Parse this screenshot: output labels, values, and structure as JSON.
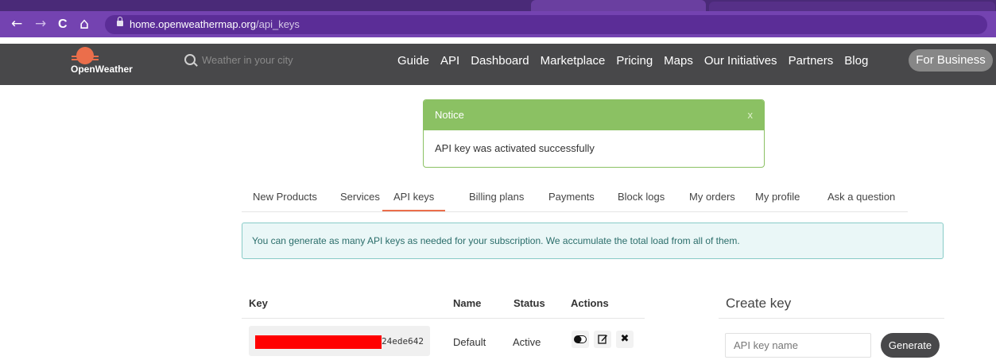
{
  "browser": {
    "url_host": "home.openweathermap.org",
    "url_path": "/api_keys",
    "back_glyph": "←",
    "forward_glyph": "→",
    "reload_glyph": "C",
    "home_glyph": "⌂"
  },
  "header": {
    "logo_text": "OpenWeather",
    "search_placeholder": "Weather in your city",
    "nav": [
      "Guide",
      "API",
      "Dashboard",
      "Marketplace",
      "Pricing",
      "Maps",
      "Our Initiatives",
      "Partners",
      "Blog"
    ],
    "for_business": "For Business"
  },
  "notice": {
    "title": "Notice",
    "close": "x",
    "message": "API key was activated successfully"
  },
  "account_tabs": [
    "New Products",
    "Services",
    "API keys",
    "Billing plans",
    "Payments",
    "Block logs",
    "My orders",
    "My profile",
    "Ask a question"
  ],
  "active_tab": "API keys",
  "info_text": "You can generate as many API keys as needed for your subscription. We accumulate the total load from all of them.",
  "keys_table": {
    "headers": {
      "key": "Key",
      "name": "Name",
      "status": "Status",
      "actions": "Actions"
    },
    "rows": [
      {
        "key_visible_suffix": "24ede642",
        "name": "Default",
        "status": "Active"
      }
    ],
    "action_icons": [
      "toggle-icon",
      "edit-icon",
      "delete-icon"
    ]
  },
  "create_key": {
    "title": "Create key",
    "input_placeholder": "API key name",
    "button": "Generate"
  },
  "colors": {
    "browser_chrome": "#7443b1",
    "site_header": "#48484a",
    "brand_orange": "#eb6e4b",
    "notice_green": "#8bc163",
    "info_border": "#88cbc7",
    "redaction": "#ff0000"
  }
}
